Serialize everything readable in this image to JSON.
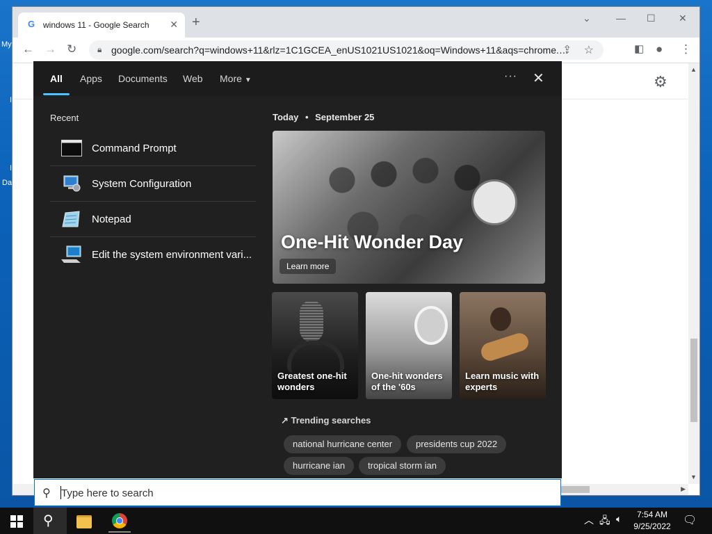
{
  "desktop": {
    "left_labels": [
      "My",
      "I",
      "I",
      "Da"
    ]
  },
  "browser": {
    "tab_title": "windows 11 - Google Search",
    "tab_favicon": "G",
    "new_tab_glyph": "+",
    "url": "google.com/search?q=windows+11&rlz=1C1GCEA_enUS1021US1021&oq=Windows+11&aqs=chrome.0...."
  },
  "panel": {
    "tabs": [
      {
        "label": "All",
        "active": true
      },
      {
        "label": "Apps",
        "active": false
      },
      {
        "label": "Documents",
        "active": false
      },
      {
        "label": "Web",
        "active": false
      },
      {
        "label": "More",
        "active": false
      }
    ],
    "recent_title": "Recent",
    "recent_items": [
      {
        "label": "Command Prompt",
        "icon": "command-prompt-icon"
      },
      {
        "label": "System Configuration",
        "icon": "system-configuration-icon"
      },
      {
        "label": "Notepad",
        "icon": "notepad-icon"
      },
      {
        "label": "Edit the system environment vari...",
        "icon": "system-properties-icon"
      }
    ],
    "today_label": "Today",
    "today_separator": "•",
    "date": "September 25",
    "hero": {
      "title": "One-Hit Wonder Day",
      "button": "Learn more"
    },
    "cards": [
      {
        "caption": "Greatest one-hit wonders"
      },
      {
        "caption": "One-hit wonders of the '60s"
      },
      {
        "caption": "Learn music with experts"
      }
    ],
    "trending_title": "Trending searches",
    "trending": [
      "national hurricane center",
      "presidents cup 2022",
      "hurricane ian",
      "tropical storm ian"
    ]
  },
  "search": {
    "placeholder": "Type here to search",
    "value": ""
  },
  "taskbar": {
    "time": "7:54 AM",
    "date": "9/25/2022"
  },
  "colors": {
    "accent": "#4cc2ff",
    "panel_bg": "#202020",
    "taskbar_bg": "#101010",
    "desktop_bg": "#0b62b8"
  }
}
